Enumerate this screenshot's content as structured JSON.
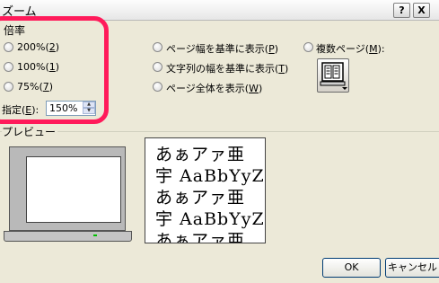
{
  "window": {
    "title": "ズーム",
    "help_label": "?",
    "close_label": "X"
  },
  "zoom": {
    "group_label": "倍率",
    "options": [
      {
        "label": "200%",
        "key": "2"
      },
      {
        "label": "100%",
        "key": "1"
      },
      {
        "label": "75%",
        "key": "7"
      }
    ],
    "custom_label": "指定(",
    "custom_key": "E",
    "custom_tail": "):",
    "custom_value": "150%"
  },
  "fit": {
    "options": [
      {
        "label": "ページ幅を基準に表示(",
        "key": "P",
        "tail": ")"
      },
      {
        "label": "文字列の幅を基準に表示(",
        "key": "T",
        "tail": ")"
      },
      {
        "label": "ページ全体を表示(",
        "key": "W",
        "tail": ")"
      }
    ]
  },
  "multi_page": {
    "label": "複数ページ(",
    "key": "M",
    "tail": "):"
  },
  "preview": {
    "group_label": "プレビュー",
    "lines": [
      "あぁアァ亜",
      "宇 AaBbYyZz",
      "あぁアァ亜",
      "宇 AaBbYyZz",
      "あぁアァ亜"
    ]
  },
  "buttons": {
    "ok": "OK",
    "cancel": "キャンセル"
  }
}
